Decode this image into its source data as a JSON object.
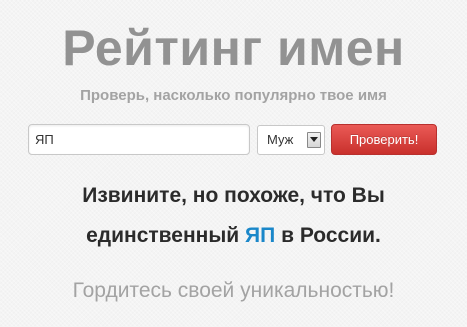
{
  "header": {
    "title": "Рейтинг имен",
    "subtitle": "Проверь, насколько популярно твое имя"
  },
  "form": {
    "name_value": "ЯП",
    "gender_selected": "Муж",
    "gender_arrow_icon": "chevron-down-icon",
    "submit_label": "Проверить!",
    "submit_color": "#d9413d"
  },
  "result": {
    "line1": "Извините, но похоже, что Вы",
    "line2_before": "единственный",
    "name": "ЯП",
    "line2_after": "в России.",
    "highlight_color": "#1a87c9"
  },
  "footer": {
    "message": "Гордитесь своей уникальностью!"
  }
}
